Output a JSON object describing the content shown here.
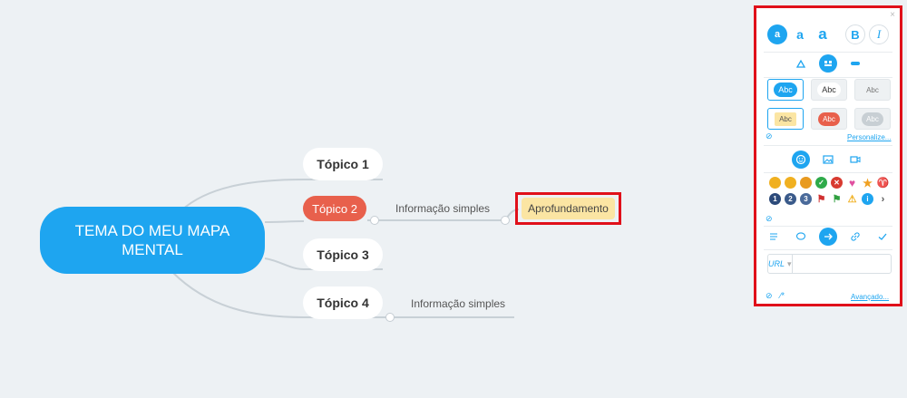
{
  "mindmap": {
    "root": "TEMA DO MEU MAPA MENTAL",
    "topics": [
      {
        "label": "Tópico 1"
      },
      {
        "label": "Tópico 2",
        "info": "Informação simples",
        "detail": "Aprofundamento"
      },
      {
        "label": "Tópico 3"
      },
      {
        "label": "Tópico 4",
        "info": "Informação simples"
      }
    ]
  },
  "panel": {
    "close": "×",
    "font_sizes": [
      "a",
      "a",
      "a"
    ],
    "bold": "B",
    "italic": "I",
    "style_samples": [
      "Abc",
      "Abc",
      "Abc",
      "Abc",
      "Abc",
      "Abc"
    ],
    "customize_link": "Personalize...",
    "link_type": "URL",
    "url_value": "",
    "advanced_link": "Avançado...",
    "colors": {
      "accent": "#1ea5f0",
      "highlight": "#e0101a",
      "topic_red": "#e8604c",
      "detail_bg": "#fbe5a3"
    }
  }
}
